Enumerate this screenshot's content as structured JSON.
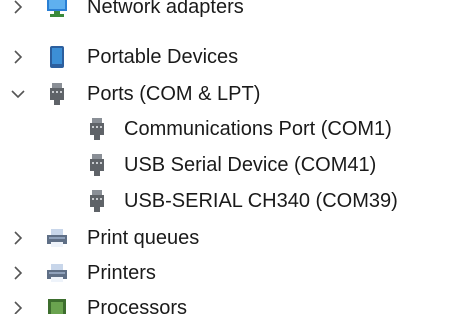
{
  "device_tree": {
    "nodes": [
      {
        "label": "Network adapters",
        "expanded": false,
        "icon": "network-adapter-icon"
      },
      {
        "label": "Portable Devices",
        "expanded": false,
        "icon": "portable-device-icon"
      },
      {
        "label": "Ports (COM & LPT)",
        "expanded": true,
        "icon": "port-connector-icon",
        "children": [
          {
            "label": "Communications Port (COM1)",
            "icon": "port-connector-icon"
          },
          {
            "label": "USB Serial Device (COM41)",
            "icon": "port-connector-icon"
          },
          {
            "label": "USB-SERIAL CH340 (COM39)",
            "icon": "port-connector-icon"
          }
        ]
      },
      {
        "label": "Print queues",
        "expanded": false,
        "icon": "printer-icon"
      },
      {
        "label": "Printers",
        "expanded": false,
        "icon": "printer-icon"
      },
      {
        "label": "Processors",
        "expanded": false,
        "icon": "processor-chip-icon"
      }
    ]
  },
  "colors": {
    "text": "#1a1a1a",
    "arrow": "#555555",
    "port_icon": "#5f6368",
    "portable_icon": "#3c8fd6",
    "network_icon": "#2a7fd4",
    "printer_body": "#5f6f86",
    "printer_paper": "#c8d6ea",
    "processor": "#3d6e2e"
  }
}
